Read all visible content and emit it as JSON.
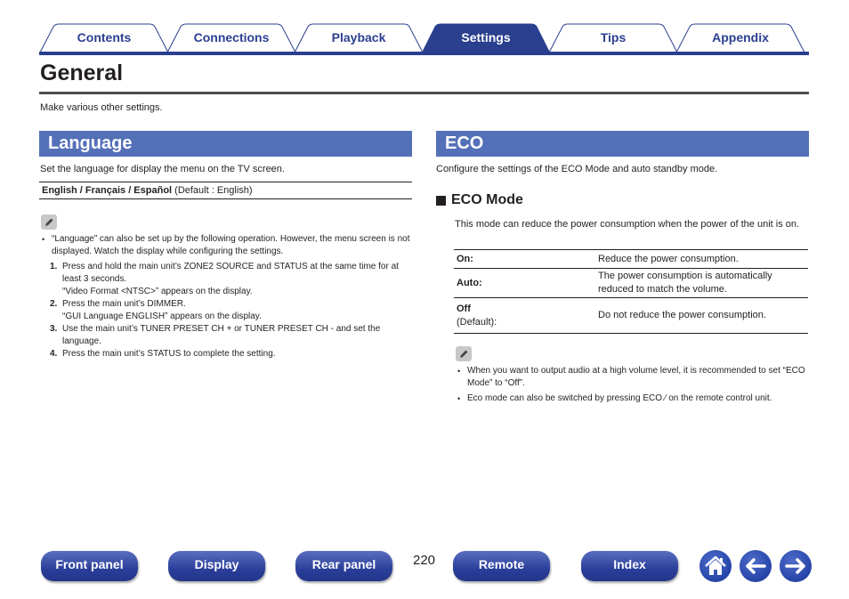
{
  "tabs": [
    {
      "label": "Contents",
      "active": false
    },
    {
      "label": "Connections",
      "active": false
    },
    {
      "label": "Playback",
      "active": false
    },
    {
      "label": "Settings",
      "active": true
    },
    {
      "label": "Tips",
      "active": false
    },
    {
      "label": "Appendix",
      "active": false
    }
  ],
  "page": {
    "title": "General",
    "intro": "Make various other settings."
  },
  "language": {
    "heading": "Language",
    "description": "Set the language for display the menu on the TV screen.",
    "options_bold": "English / Français / Español",
    "options_default": " (Default : English)",
    "note_icon": "pencil-icon",
    "note_bullet": "“Language” can also be set up by the following operation. However, the menu screen is not displayed. Watch the display while configuring the settings.",
    "steps": [
      {
        "num": "1.",
        "text": "Press and hold the main unit’s ZONE2 SOURCE and STATUS at the same time for at least 3 seconds.",
        "sub": "“Video Format <NTSC>” appears on the display."
      },
      {
        "num": "2.",
        "text": "Press the main unit’s DIMMER.",
        "sub": "“GUI Language ENGLISH” appears on the display."
      },
      {
        "num": "3.",
        "text": "Use the main unit’s TUNER PRESET CH + or TUNER PRESET CH - and set the language.",
        "sub": ""
      },
      {
        "num": "4.",
        "text": "Press the main unit’s STATUS to complete the setting.",
        "sub": ""
      }
    ]
  },
  "eco": {
    "heading": "ECO",
    "description": "Configure the settings of the ECO Mode and auto standby mode.",
    "mode_heading": "ECO Mode",
    "mode_description": "This mode can reduce the power consumption when the power of the unit is on.",
    "table": [
      {
        "key": "On:",
        "key_sub": "",
        "value": "Reduce the power consumption."
      },
      {
        "key": "Auto:",
        "key_sub": "",
        "value": "The power consumption is automatically reduced to match the volume."
      },
      {
        "key": "Off",
        "key_sub": "(Default):",
        "value": "Do not reduce the power consumption."
      }
    ],
    "notes": [
      "When you want to output audio at a high volume level, it is recommended to set “ECO Mode” to “Off”.",
      "Eco mode can also be switched by pressing ECO ⁄ on the remote control unit."
    ]
  },
  "footer": {
    "buttons": [
      "Front panel",
      "Display",
      "Rear panel",
      "Remote",
      "Index"
    ],
    "page_number": "220",
    "icons": [
      "home-icon",
      "back-arrow-icon",
      "forward-arrow-icon"
    ]
  },
  "colors": {
    "tab_active": "#2b3f8f",
    "section_bar": "#5470b8",
    "nav_button": "#2b3f9a"
  }
}
